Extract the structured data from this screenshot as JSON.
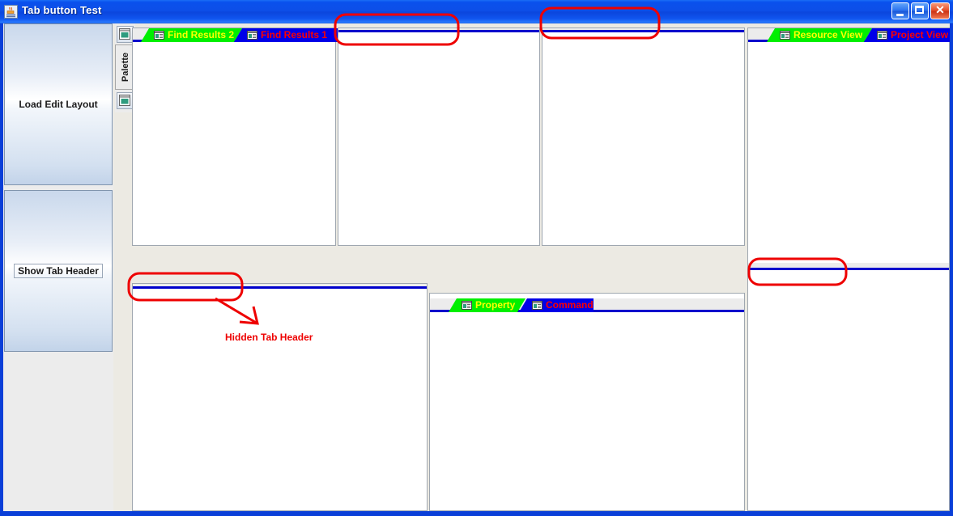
{
  "window": {
    "title": "Tab button Test",
    "icon": "java-coffee-cup-icon",
    "controls": {
      "minimize": "_",
      "maximize": "□",
      "close": "✕"
    }
  },
  "colors": {
    "titlebar_blue": "#0a50ec",
    "window_border": "#0a3fd8",
    "tab_selected_bg": "#00ef00",
    "tab_selected_fg": "#ffff00",
    "tab_unselected_bg": "#0000e8",
    "tab_unselected_fg": "#ff0000",
    "tab_underline": "#0000cc",
    "annotation_red": "#e00000",
    "panel_bg": "#ffffff",
    "client_bg": "#ececec"
  },
  "sidebar": {
    "buttons": [
      {
        "label": "Load Edit Layout",
        "name": "load-edit-layout-button",
        "focused": false
      },
      {
        "label": "Show Tab Header",
        "name": "show-tab-header-button",
        "focused": true
      }
    ]
  },
  "palette": {
    "label": "Palette",
    "top_icon": "palette-window-icon",
    "bottom_icon": "palette-window-icon"
  },
  "panels": [
    {
      "id": "find-results-panel",
      "header_visible": true,
      "tabs": [
        {
          "label": "Find Results 2",
          "state": "selected",
          "icon": "document-window-icon"
        },
        {
          "label": "Find Results 1",
          "state": "unselected",
          "icon": "document-window-icon"
        }
      ]
    },
    {
      "id": "top-middle-panel",
      "header_visible": false,
      "tabs": []
    },
    {
      "id": "top-right-inner-panel",
      "header_visible": false,
      "tabs": []
    },
    {
      "id": "view-panel",
      "header_visible": true,
      "tabs": [
        {
          "label": "Resource View",
          "state": "selected",
          "icon": "document-window-icon"
        },
        {
          "label": "Project View",
          "state": "unselected",
          "icon": "document-window-icon"
        }
      ]
    },
    {
      "id": "bottom-left-panel",
      "header_visible": false,
      "tabs": []
    },
    {
      "id": "property-command-panel",
      "header_visible": true,
      "tabs": [
        {
          "label": "Property",
          "state": "selected",
          "icon": "document-window-icon"
        },
        {
          "label": "Command",
          "state": "unselected",
          "icon": "document-window-icon"
        }
      ]
    },
    {
      "id": "bottom-right-panel",
      "header_visible": false,
      "tabs": []
    }
  ],
  "annotations": {
    "callout_label": "Hidden Tab Header",
    "marked_regions": [
      "top-middle-panel-hidden-header",
      "top-right-panel-hidden-header",
      "bottom-left-panel-hidden-header",
      "right-panel-hidden-header"
    ]
  }
}
